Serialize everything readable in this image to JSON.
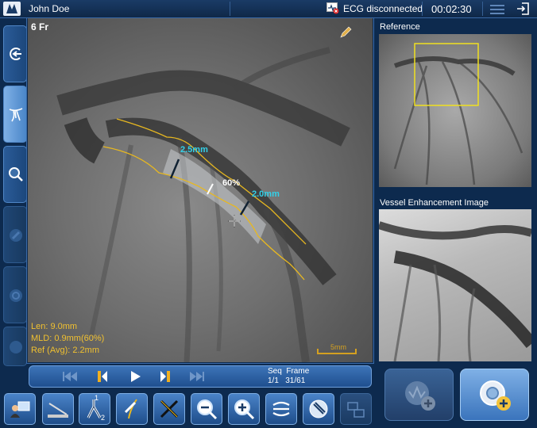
{
  "header": {
    "patient_name": "John Doe",
    "ecg_status": "ECG disconnected",
    "timer": "00:02:30"
  },
  "main_view": {
    "catheter_size": "6 Fr",
    "measurements": {
      "proximal_diameter": "2.5mm",
      "distal_diameter": "2.0mm",
      "stenosis_percent": "60%"
    },
    "stats": {
      "length": "Len: 9.0mm",
      "mld": "MLD: 0.9mm(60%)",
      "ref_avg": "Ref (Avg): 2.2mm"
    },
    "scale_label": "5mm"
  },
  "navigation": {
    "seq_label": "Seq",
    "frame_label": "Frame",
    "seq_value": "1/1",
    "frame_value": "31/61"
  },
  "panels": {
    "reference_title": "Reference",
    "enhancement_title": "Vessel Enhancement Image"
  },
  "colors": {
    "accent_cyan": "#33d0e8",
    "contour_yellow": "#e8b820",
    "stats_yellow": "#f0c030",
    "panel_blue": "#0d2a4e"
  },
  "toolbar": {
    "badge_1": "1",
    "badge_2": "2"
  }
}
